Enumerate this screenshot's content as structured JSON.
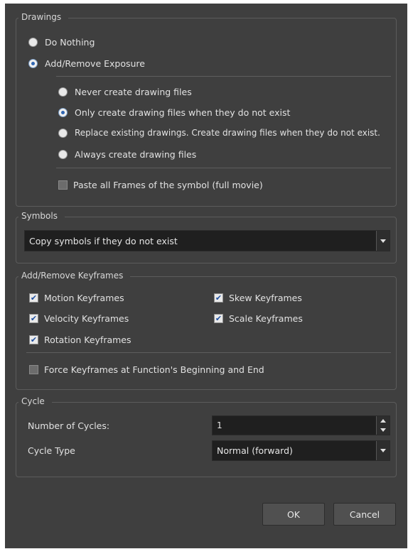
{
  "drawings": {
    "title": "Drawings",
    "option_do_nothing": "Do Nothing",
    "option_add_remove": "Add/Remove Exposure",
    "sub_options": [
      "Never create drawing files",
      "Only create drawing files when they do not exist",
      "Replace existing drawings. Create drawing files when they do not exist.",
      "Always create drawing files"
    ],
    "paste_all": "Paste all Frames of the symbol (full movie)"
  },
  "symbols": {
    "title": "Symbols",
    "selected": "Copy symbols if they do not exist"
  },
  "keyframes": {
    "title": "Add/Remove Keyframes",
    "motion": "Motion Keyframes",
    "skew": "Skew Keyframes",
    "velocity": "Velocity Keyframes",
    "scale": "Scale Keyframes",
    "rotation": "Rotation Keyframes",
    "force": "Force Keyframes at Function's Beginning and End"
  },
  "cycle": {
    "title": "Cycle",
    "num_label": "Number of Cycles:",
    "num_value": "1",
    "type_label": "Cycle Type",
    "type_value": "Normal (forward)"
  },
  "buttons": {
    "ok": "OK",
    "cancel": "Cancel"
  },
  "icons": {
    "checkmark": "✔"
  },
  "colors": {
    "dialog_bg": "#3f3f3f",
    "field_bg": "#1f1f1f",
    "radio_dot": "#2f66b3"
  }
}
